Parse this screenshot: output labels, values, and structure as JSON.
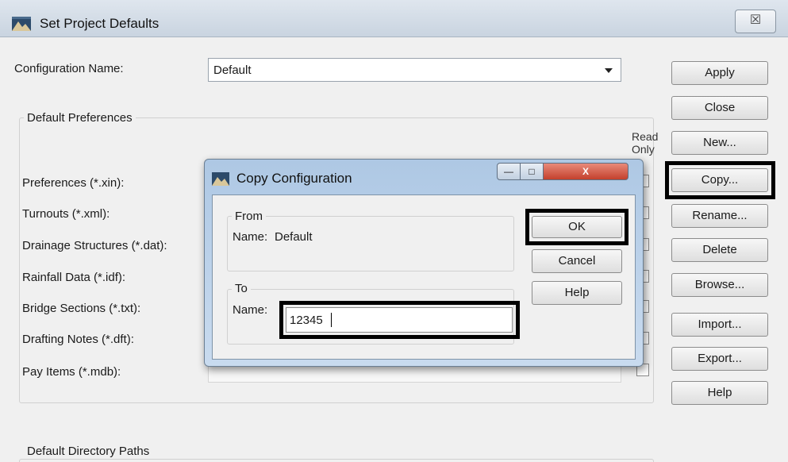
{
  "window": {
    "title": "Set Project Defaults",
    "close_glyph": "☒",
    "icon": "app-icon"
  },
  "config": {
    "label": "Configuration Name:",
    "value": "Default"
  },
  "preferences": {
    "group_label": "Default Preferences",
    "read_only_line1": "Read",
    "read_only_line2": "Only",
    "rows": [
      "Preferences (*.xin):",
      "Turnouts (*.xml):",
      "Drainage Structures (*.dat):",
      "Rainfall Data (*.idf):",
      "Bridge Sections (*.txt):",
      "Drafting Notes (*.dft):",
      "Pay Items (*.mdb):"
    ]
  },
  "directory": {
    "group_label": "Default Directory Paths"
  },
  "side_buttons": [
    "Apply",
    "Close",
    "New...",
    "Copy...",
    "Rename...",
    "Delete",
    "Browse...",
    "Import...",
    "Export...",
    "Help"
  ],
  "dialog": {
    "title": "Copy Configuration",
    "close_glyph": "X",
    "min_glyph": "—",
    "max_glyph": "□",
    "from": {
      "group_label": "From",
      "name_label": "Name:",
      "name_value": "Default"
    },
    "to": {
      "group_label": "To",
      "name_label": "Name:",
      "name_value": "12345"
    },
    "ok": "OK",
    "cancel": "Cancel",
    "help": "Help"
  },
  "colors": {
    "highlight": "#000000",
    "dialog_frame": "#aec8e4",
    "close_button": "#c4402c"
  }
}
